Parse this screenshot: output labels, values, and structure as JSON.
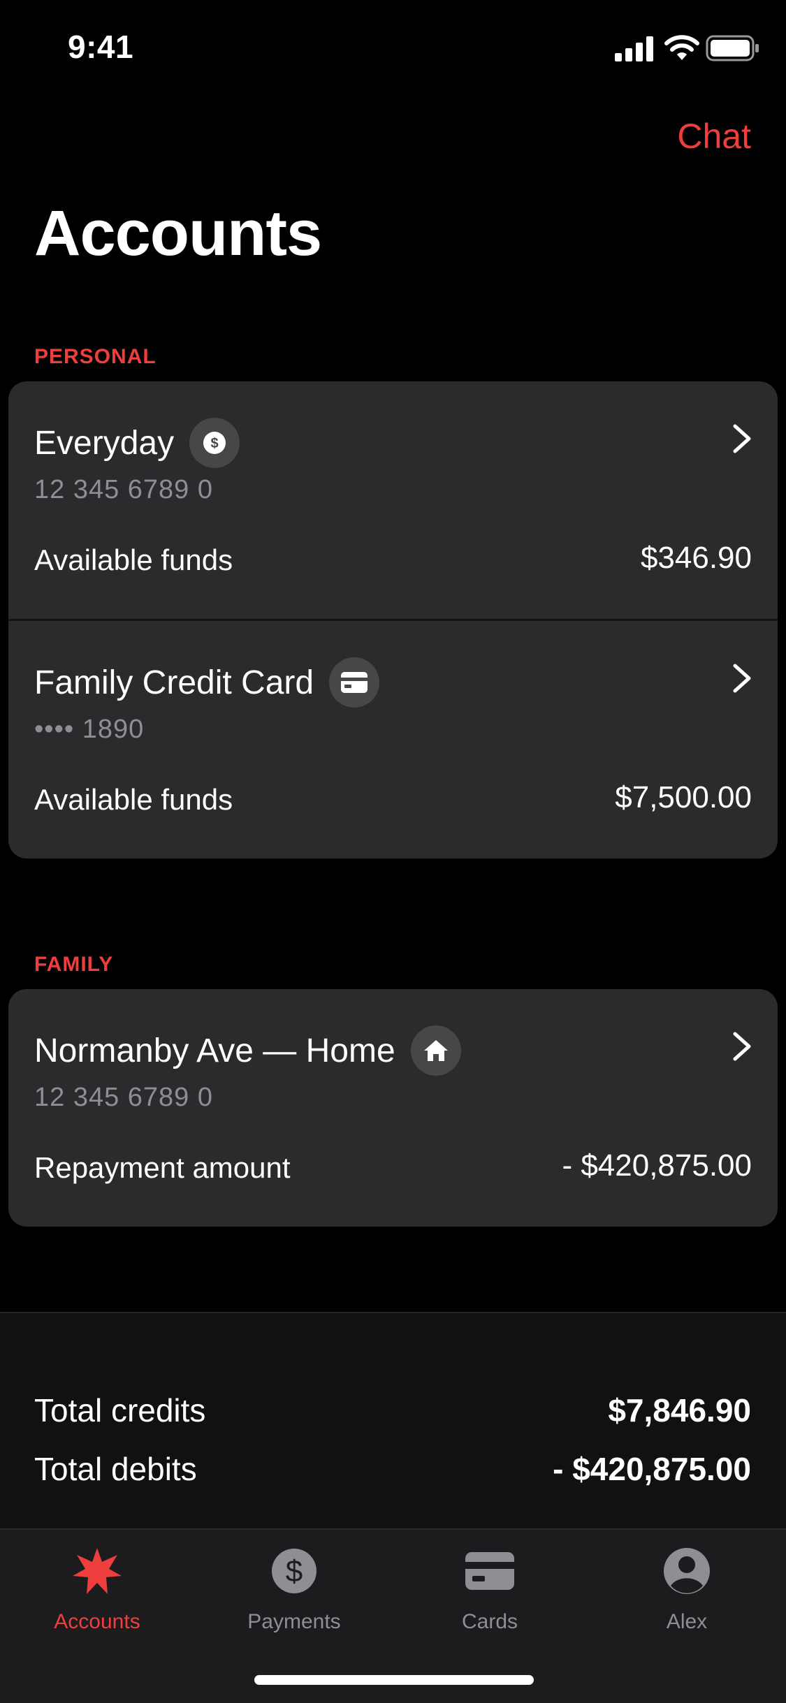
{
  "status_bar": {
    "time": "9:41"
  },
  "header": {
    "chat_label": "Chat",
    "title": "Accounts"
  },
  "sections": {
    "personal": {
      "label": "PERSONAL",
      "accounts": [
        {
          "name": "Everyday",
          "number": "12 345 6789 0",
          "funds_label": "Available funds",
          "amount": "$346.90",
          "icon": "dollar-icon"
        },
        {
          "name": "Family Credit Card",
          "number": "•••• 1890",
          "funds_label": "Available funds",
          "amount": "$7,500.00",
          "icon": "card-icon"
        }
      ]
    },
    "family": {
      "label": "FAMILY",
      "accounts": [
        {
          "name": "Normanby Ave — Home",
          "number": "12 345 6789 0",
          "funds_label": "Repayment amount",
          "amount": "- $420,875.00",
          "icon": "home-icon"
        }
      ]
    }
  },
  "totals": {
    "credits_label": "Total credits",
    "credits_value": "$7,846.90",
    "debits_label": "Total debits",
    "debits_value": "- $420,875.00"
  },
  "tabs": [
    {
      "label": "Accounts",
      "icon": "star-logo-icon",
      "active": true
    },
    {
      "label": "Payments",
      "icon": "dollar-circle-icon",
      "active": false
    },
    {
      "label": "Cards",
      "icon": "card-icon",
      "active": false
    },
    {
      "label": "Alex",
      "icon": "profile-icon",
      "active": false
    }
  ],
  "colors": {
    "accent": "#ef3e3e",
    "card_bg": "#2b2b2d",
    "background": "#000000"
  }
}
